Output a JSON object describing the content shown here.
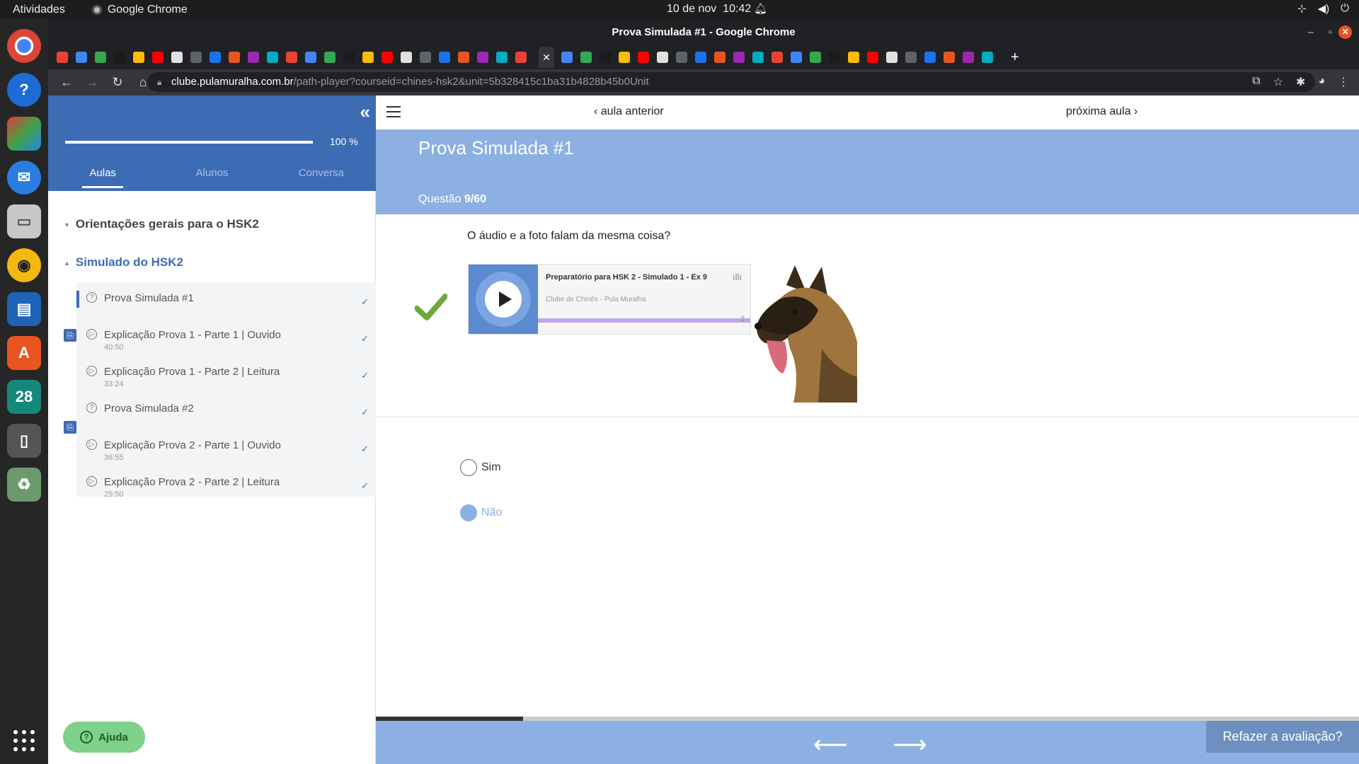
{
  "os": {
    "activities": "Atividades",
    "app_name": "Google Chrome",
    "date": "10 de nov",
    "time": "10:42",
    "dock_calendar_day": "28"
  },
  "window": {
    "title": "Prova Simulada #1 - Google Chrome"
  },
  "browser": {
    "url_host": "clube.pulamuralha.com.br",
    "url_path": "/path-player?courseid=chines-hsk2&unit=5b328415c1ba31b4828b45b0Unit"
  },
  "sidebar": {
    "progress_text": "100 %",
    "progress": 1.0,
    "tabs": [
      "Aulas",
      "Alunos",
      "Conversa"
    ],
    "sections": [
      {
        "title": "Orientações gerais para o HSK2",
        "expanded": false
      },
      {
        "title": "Simulado do HSK2",
        "expanded": true
      }
    ],
    "lessons": [
      {
        "title": "Prova Simulada #1",
        "duration": "",
        "icon": "question-icon",
        "current": true,
        "attachment": false
      },
      {
        "title": "Explicação Prova 1 - Parte 1 | Ouvido",
        "duration": "40:50",
        "icon": "play-icon",
        "current": false,
        "attachment": true
      },
      {
        "title": "Explicação Prova 1 - Parte 2 | Leitura",
        "duration": "33:24",
        "icon": "play-icon",
        "current": false,
        "attachment": false
      },
      {
        "title": "Prova Simulada #2",
        "duration": "",
        "icon": "question-icon",
        "current": false,
        "attachment": false
      },
      {
        "title": "Explicação Prova 2 - Parte 1 | Ouvido",
        "duration": "36:55",
        "icon": "play-icon",
        "current": false,
        "attachment": true
      },
      {
        "title": "Explicação Prova 2 - Parte 2 | Leitura",
        "duration": "25:50",
        "icon": "play-icon",
        "current": false,
        "attachment": false
      }
    ],
    "help_label": "Ajuda"
  },
  "main": {
    "prev_label": "aula anterior",
    "next_label": "próxima aula",
    "title": "Prova Simulada #1",
    "question_prefix": "Questão",
    "question_number": "9/60",
    "question_text": "O áudio e a foto falam da mesma coisa?",
    "audio": {
      "title": "Preparatório para HSK 2 - Simulado 1 - Ex 9",
      "author": "Clube de Chinês - Pula Muralha"
    },
    "options": [
      {
        "label": "Sim",
        "selected": false
      },
      {
        "label": "Não",
        "selected": true
      }
    ],
    "redo_label": "Refazer a avaliação?",
    "quiz_progress": 0.15
  },
  "colors": {
    "primary": "#3d6cb4",
    "banner": "#8cb0e2",
    "correct": "#6fa83a",
    "help": "#7fd088"
  }
}
